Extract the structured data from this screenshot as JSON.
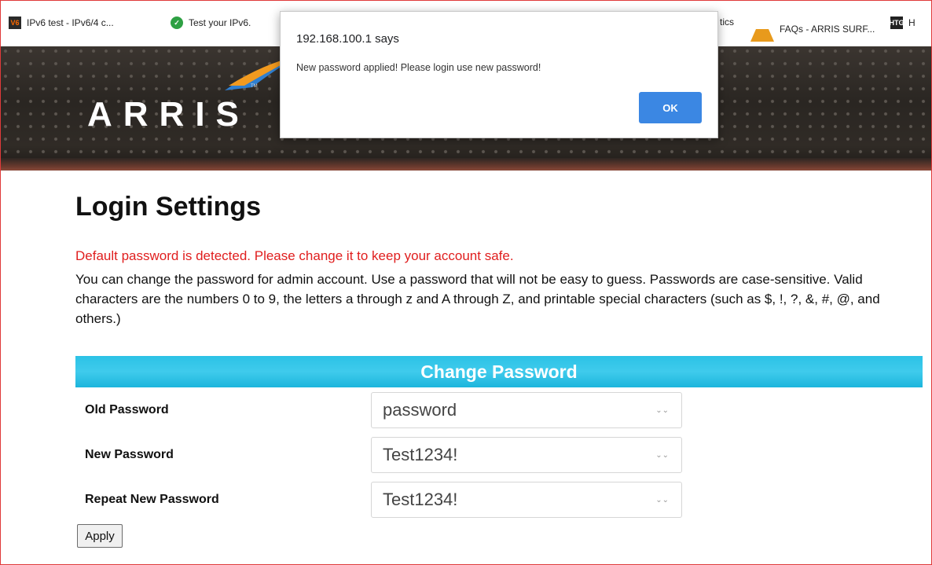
{
  "bookmarks": [
    {
      "label": "IPv6 test - IPv6/4 c...",
      "icon": "v6-icon",
      "badge": "V6"
    },
    {
      "label": "Test your IPv6.",
      "icon": "check-icon"
    },
    {
      "label": "tics",
      "icon": ""
    },
    {
      "label": "FAQs - ARRIS SURF...",
      "icon": "arris-icon"
    },
    {
      "label": "H",
      "icon": "htg-icon",
      "badge": "HTG"
    }
  ],
  "header": {
    "logo_text": "ARRIS",
    "logo_tm": "TM"
  },
  "dialog": {
    "title": "192.168.100.1 says",
    "message": "New password applied! Please login use new password!",
    "ok_label": "OK"
  },
  "page": {
    "title": "Login Settings",
    "warning": "Default password is detected. Please change it to keep your account safe.",
    "description": "You can change the password for admin account. Use a password that will not be easy to guess. Passwords are case-sensitive. Valid characters are the numbers 0 to 9, the letters a through z and A through Z, and printable special characters (such as $, !, ?, &, #, @, and others.)"
  },
  "form": {
    "section_title": "Change Password",
    "fields": [
      {
        "label": "Old Password",
        "value": "password"
      },
      {
        "label": "New Password",
        "value": "Test1234!"
      },
      {
        "label": "Repeat New Password",
        "value": "Test1234!"
      }
    ],
    "apply_label": "Apply"
  },
  "colors": {
    "warning": "#e01e1e",
    "section_bar": "#2cc2e6",
    "ok_button": "#3b87e3",
    "frame_border": "#e03a3a"
  }
}
